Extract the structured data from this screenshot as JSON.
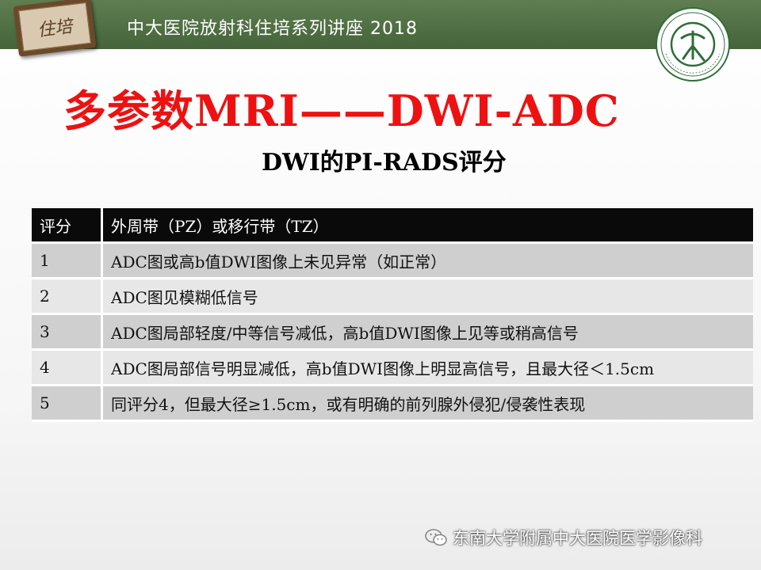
{
  "header": {
    "title": "中大医院放射科住培系列讲座 2018",
    "badge_text": "住培"
  },
  "slide": {
    "title": "多参数MRI——DWI-ADC",
    "subtitle": "DWI的PI-RADS评分"
  },
  "table": {
    "headers": [
      "评分",
      "外周带（PZ）或移行带（TZ）"
    ],
    "rows": [
      {
        "score": "1",
        "desc": "ADC图或高b值DWI图像上未见异常（如正常）"
      },
      {
        "score": "2",
        "desc": "ADC图见模糊低信号"
      },
      {
        "score": "3",
        "desc": "ADC图局部轻度/中等信号减低，高b值DWI图像上见等或稍高信号"
      },
      {
        "score": "4",
        "desc": "ADC图局部信号明显减低，高b值DWI图像上明显高信号，且最大径＜1.5cm"
      },
      {
        "score": "5",
        "desc": "同评分4，但最大径≥1.5cm，或有明确的前列腺外侵犯/侵袭性表现"
      }
    ]
  },
  "footer": {
    "text": "东南大学附属中大医院医学影像科",
    "icon": "wechat-icon"
  },
  "colors": {
    "header_green": "#4f6e43",
    "title_red": "#ee1111",
    "table_header": "#0a0a0a",
    "row_dark": "#cfcfcf",
    "row_light": "#e7e7e7"
  }
}
